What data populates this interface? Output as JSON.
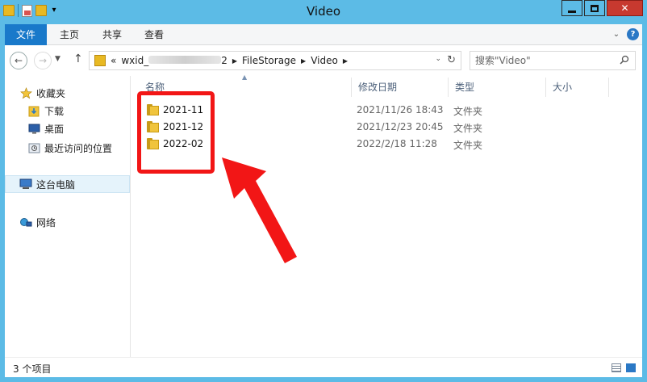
{
  "window": {
    "title": "Video"
  },
  "ribbon": {
    "tabs": [
      "文件",
      "主页",
      "共享",
      "查看"
    ]
  },
  "address": {
    "prefix": "«",
    "segment1": "wxid_",
    "segment1_tail": "2",
    "segment2": "FileStorage",
    "segment3": "Video"
  },
  "search": {
    "placeholder": "搜索\"Video\""
  },
  "navpane": {
    "favorites": "收藏夹",
    "downloads": "下载",
    "desktop": "桌面",
    "recent": "最近访问的位置",
    "this_pc": "这台电脑",
    "network": "网络"
  },
  "columns": {
    "name": "名称",
    "date": "修改日期",
    "type": "类型",
    "size": "大小"
  },
  "files": [
    {
      "name": "2021-11",
      "date": "2021/11/26 18:43",
      "type": "文件夹"
    },
    {
      "name": "2021-12",
      "date": "2021/12/23 20:45",
      "type": "文件夹"
    },
    {
      "name": "2022-02",
      "date": "2022/2/18 11:28",
      "type": "文件夹"
    }
  ],
  "status": {
    "count_text": "3 个项目"
  },
  "colors": {
    "titlebar": "#5cbbe6",
    "file_tab": "#1979ca",
    "close_button": "#c7392f",
    "annotation_red": "#f21616",
    "folder_yellow": "#f0c43c"
  }
}
